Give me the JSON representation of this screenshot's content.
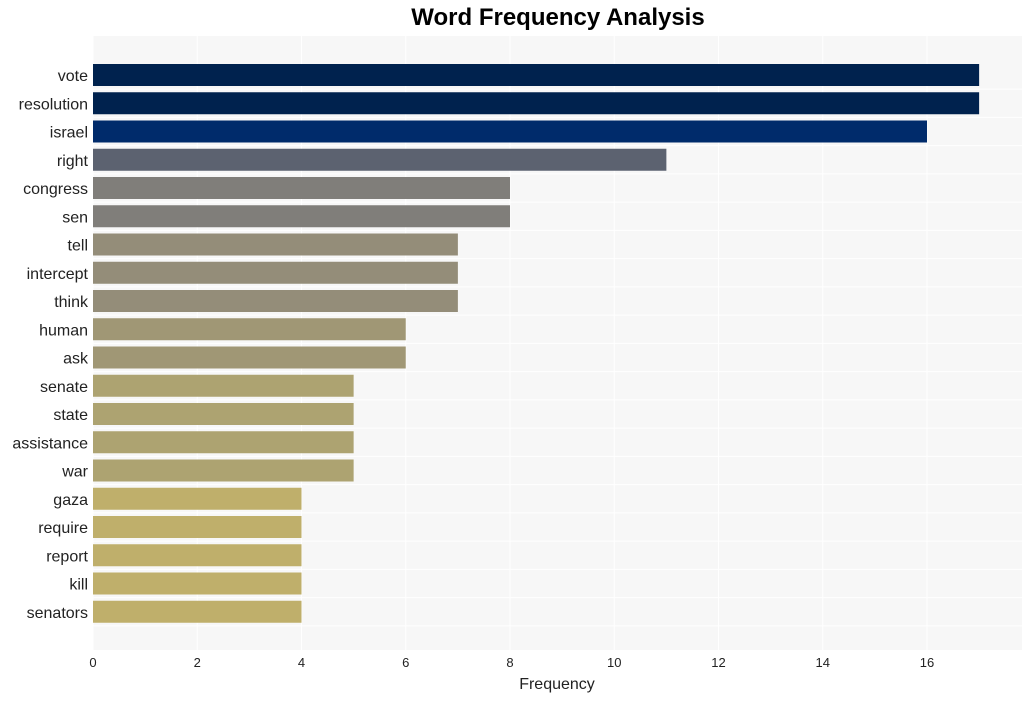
{
  "chart_data": {
    "type": "bar",
    "orientation": "horizontal",
    "title": "Word Frequency Analysis",
    "xlabel": "Frequency",
    "ylabel": "",
    "xlim": [
      0,
      17.8
    ],
    "xticks": [
      0,
      2,
      4,
      6,
      8,
      10,
      12,
      14,
      16
    ],
    "grid": true,
    "categories": [
      "vote",
      "resolution",
      "israel",
      "right",
      "congress",
      "sen",
      "tell",
      "intercept",
      "think",
      "human",
      "ask",
      "senate",
      "state",
      "assistance",
      "war",
      "gaza",
      "require",
      "report",
      "kill",
      "senators"
    ],
    "values": [
      17,
      17,
      16,
      11,
      8,
      8,
      7,
      7,
      7,
      6,
      6,
      5,
      5,
      5,
      5,
      4,
      4,
      4,
      4,
      4
    ],
    "colors": [
      "#00224e",
      "#00224e",
      "#002b6b",
      "#5c6270",
      "#807e7a",
      "#807e7a",
      "#948d79",
      "#948d79",
      "#948d79",
      "#a09775",
      "#a09775",
      "#ada371",
      "#ada371",
      "#ada371",
      "#ada371",
      "#bfaf6b",
      "#bfaf6b",
      "#bfaf6b",
      "#bfaf6b",
      "#bfaf6b"
    ],
    "background": "#f7f7f7"
  }
}
